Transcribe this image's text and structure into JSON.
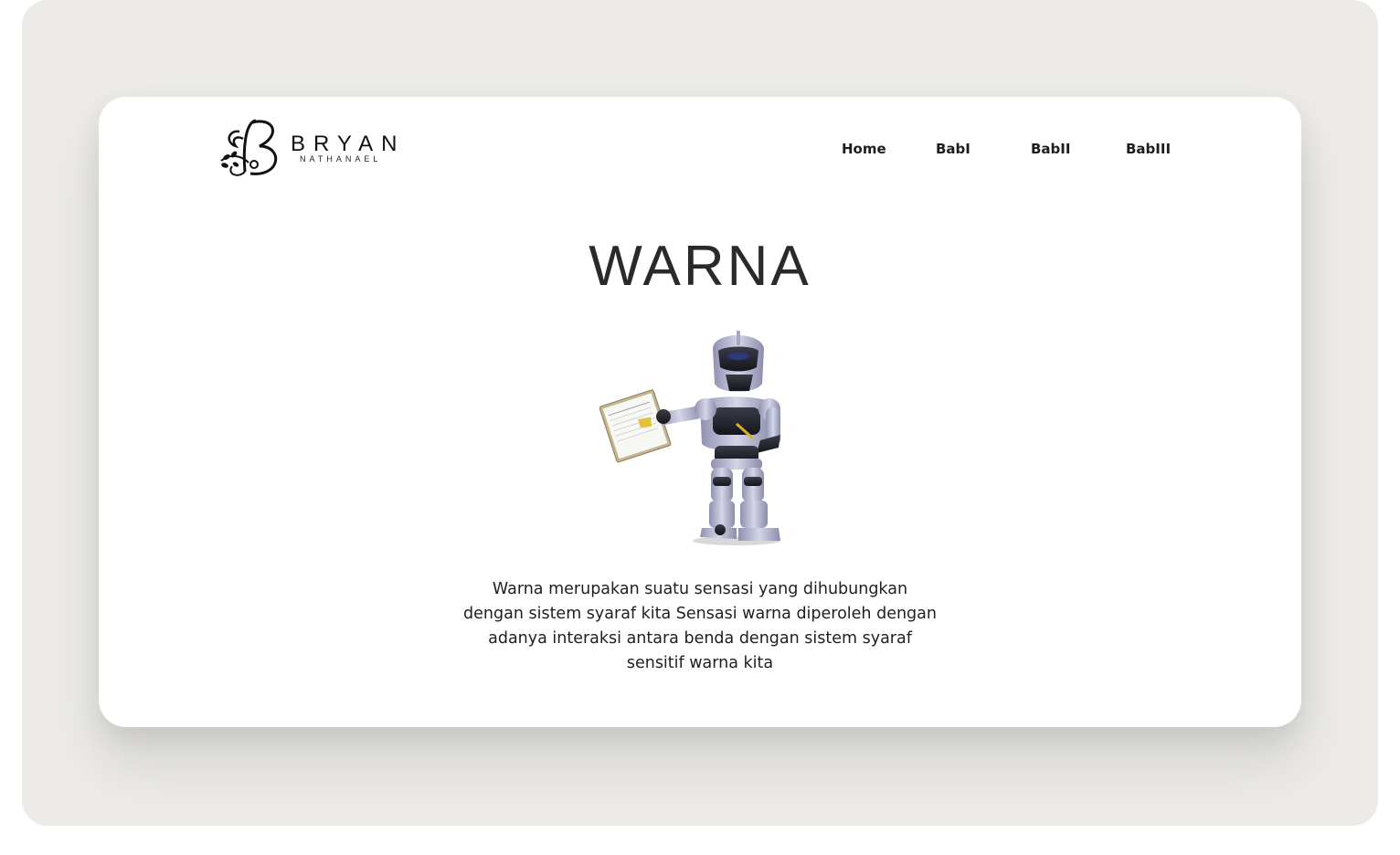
{
  "logo": {
    "monogram": "B",
    "name": "BRYAN",
    "subtitle": "NATHANAEL"
  },
  "nav": {
    "items": [
      "Home",
      "BabI",
      "BabII",
      "BabIII"
    ]
  },
  "main": {
    "title": "WARNA",
    "description": "Warna merupakan suatu sensasi yang dihubungkan dengan sistem syaraf kita Sensasi warna diperoleh dengan adanya interaksi antara benda dengan sistem syaraf sensitif warna kita",
    "illustration": "robot-with-clipboard-icon"
  },
  "colors": {
    "backdrop": "#ecebe8",
    "card": "#ffffff",
    "text": "#1f1f1f",
    "robot_body": "#b4b6d2",
    "note": "#e2c23a"
  }
}
